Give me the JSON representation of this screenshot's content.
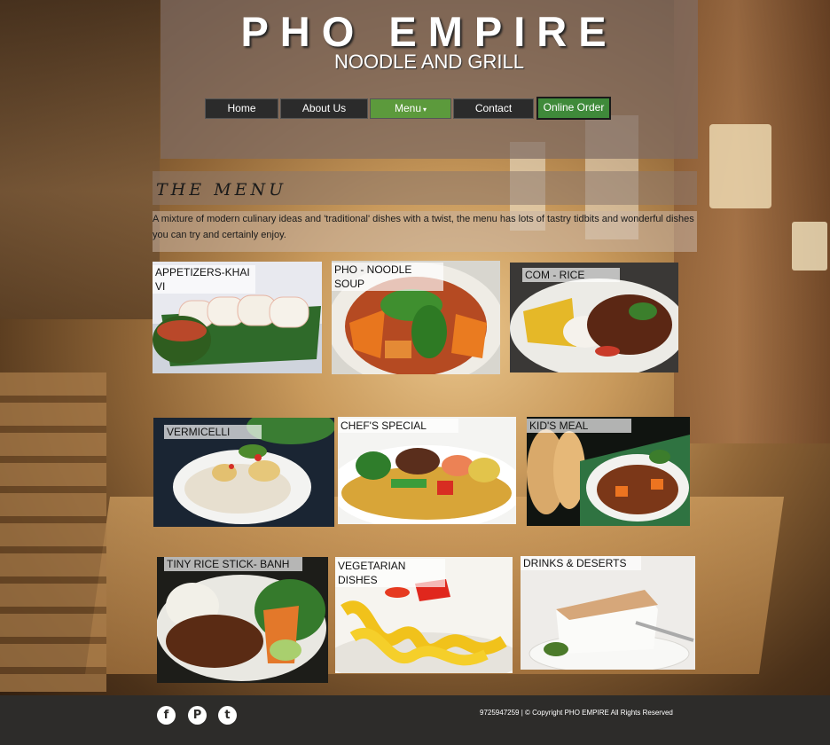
{
  "brand": {
    "title": "PHO EMPIRE",
    "subtitle": "NOODLE AND GRILL"
  },
  "nav": {
    "items": [
      {
        "label": "Home"
      },
      {
        "label": "About Us"
      },
      {
        "label": "Menu"
      },
      {
        "label": "Contact"
      }
    ],
    "menu_caret": "▾",
    "online_order": "Online Order",
    "active_color": "#5c9a3c",
    "order_color": "#3f8a3a"
  },
  "menu_section": {
    "heading": "THE MENU",
    "intro": "A mixture of modern culinary ideas and 'traditional' dishes with a twist, the menu has lots of tastry tidbits and wonderful dishes you can try and certainly enjoy."
  },
  "categories": [
    {
      "label": "APPETIZERS-KHAI VI"
    },
    {
      "label": "PHO - NOODLE SOUP"
    },
    {
      "label": "COM - RICE"
    },
    {
      "label": "VERMICELLI"
    },
    {
      "label": "CHEF'S SPECIAL"
    },
    {
      "label": "KID'S MEAL"
    },
    {
      "label": "TINY RICE STICK- BANH"
    },
    {
      "label": "VEGETARIAN DISHES"
    },
    {
      "label": "DRINKS & DESERTS"
    }
  ],
  "footer": {
    "social": [
      {
        "icon": "facebook-icon",
        "glyph": "f"
      },
      {
        "icon": "pinterest-icon",
        "glyph": "P"
      },
      {
        "icon": "twitter-icon",
        "glyph": "t"
      }
    ],
    "copyright": "9725947259 | © Copyright PHO EMPIRE All Rights Reserved"
  }
}
